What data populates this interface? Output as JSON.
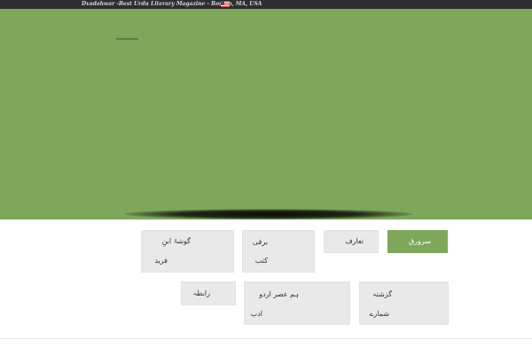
{
  "topbar": {
    "tagline": "Dvadahwar -Best Urdu Literary Magazine - Boston, MA, USA",
    "flag_icon": "us-flag-icon"
  },
  "colors": {
    "accent": "#7ea75b",
    "topbar": "#2e2e2e",
    "button_bg": "#e9e9e9"
  },
  "nav": {
    "sarwaraq": "سرورق",
    "taaruf": "تعارف",
    "barqi_line1": "برقی",
    "barqi_line2": "کتب",
    "goshay_line1": "گوشۂ ابنِ",
    "goshay_line2": "فرید",
    "guzishta_line1": "گزشتہ",
    "guzishta_line2": "شمارے",
    "hum_asr_line1": "ہم عصر اردو",
    "hum_asr_line2": "ادب",
    "rabta": "رابطہ"
  }
}
